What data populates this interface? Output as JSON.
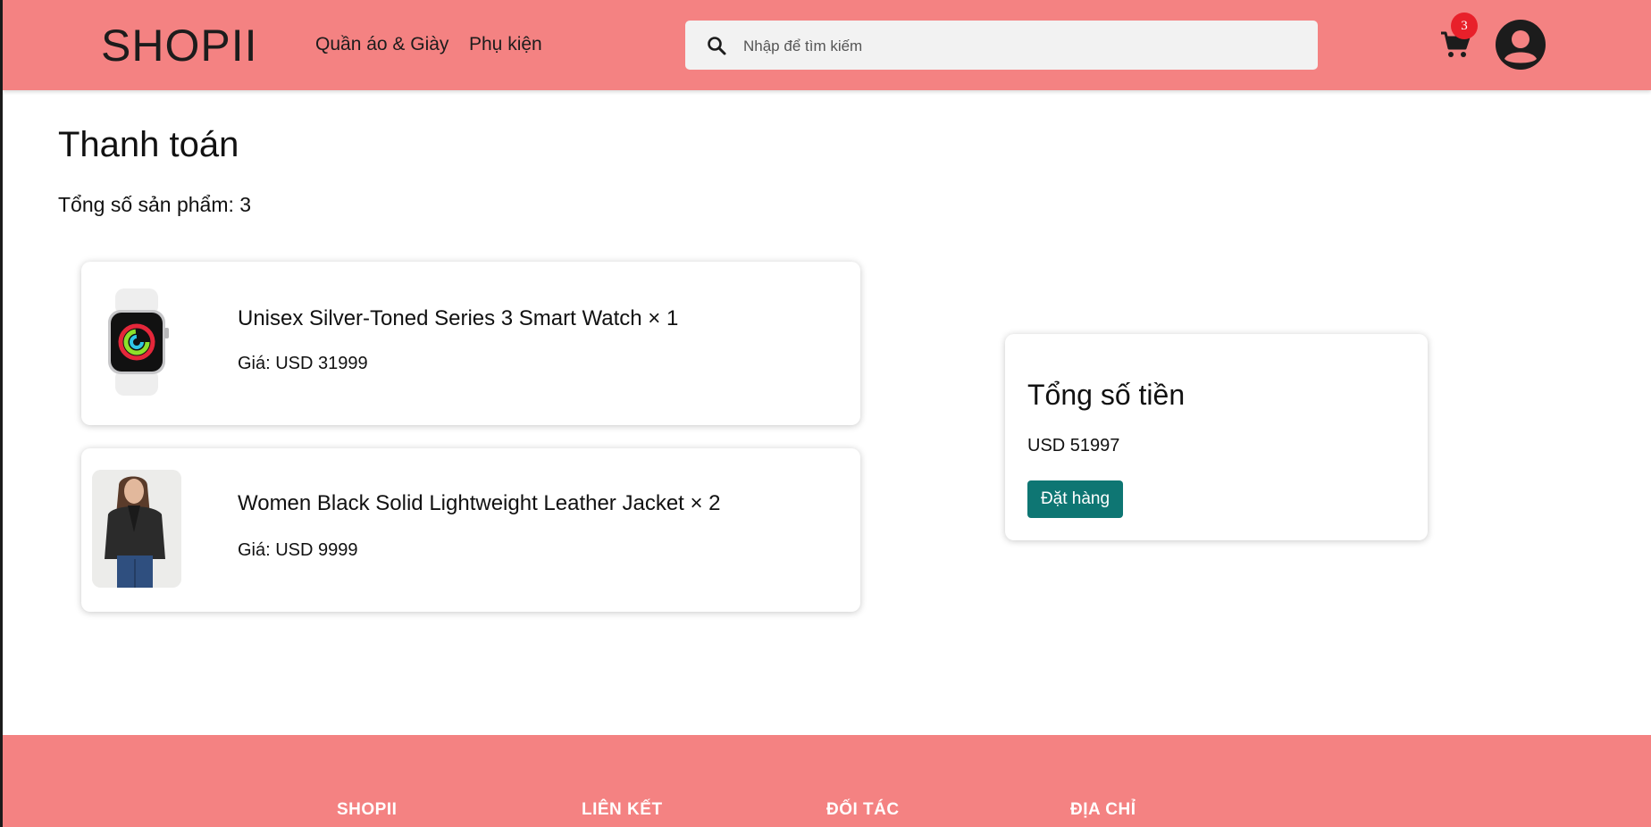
{
  "header": {
    "brand": "SHOPII",
    "nav": [
      {
        "label": "Quần áo & Giày"
      },
      {
        "label": "Phụ kiện"
      }
    ],
    "search": {
      "placeholder": "Nhập để tìm kiếm",
      "value": ""
    },
    "cart_count": "3",
    "icons": {
      "search": "search-icon",
      "cart": "cart-icon",
      "user": "user-circle-icon"
    }
  },
  "main": {
    "title": "Thanh toán",
    "count_label": "Tổng số sản phẩm: 3",
    "items": [
      {
        "name": "Unisex Silver-Toned Series 3 Smart Watch × 1",
        "price": "Giá: USD 31999",
        "image": "smart-watch"
      },
      {
        "name": "Women Black Solid Lightweight Leather Jacket × 2",
        "price": "Giá: USD 9999",
        "image": "leather-jacket"
      }
    ]
  },
  "summary": {
    "title": "Tổng số tiền",
    "total": "USD 51997",
    "button": "Đặt hàng"
  },
  "footer": {
    "columns": [
      "SHOPII",
      "LIÊN KẾT",
      "ĐỐI TÁC",
      "ĐỊA CHỈ"
    ]
  },
  "colors": {
    "header_bg": "#f48282",
    "button_bg": "#0e7673",
    "badge_bg": "#e8202a"
  }
}
